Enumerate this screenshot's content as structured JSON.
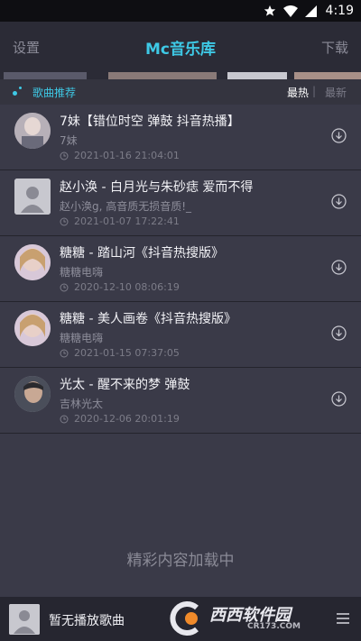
{
  "status_bar": {
    "time": "4:19"
  },
  "header": {
    "left_label": "设置",
    "title": "Mc音乐库",
    "right_label": "下载"
  },
  "section": {
    "title": "歌曲推荐",
    "sort_hot": "最热",
    "sort_separator": "|",
    "sort_new": "最新"
  },
  "songs": [
    {
      "title": "7妹【错位时空 弹鼓 抖音热播】",
      "artist": "7妹",
      "time": "2021-01-16 21:04:01",
      "avatar": "photo"
    },
    {
      "title": "赵小涣 - 白月光与朱砂痣 爱而不得",
      "artist": "赵小涣g,     高音质无损音质!_",
      "time": "2021-01-07 17:22:41",
      "avatar": "placeholder"
    },
    {
      "title": "糖糖 - 踏山河《抖音热搜版》",
      "artist": "糖糖电嗨",
      "time": "2020-12-10 08:06:19",
      "avatar": "photo"
    },
    {
      "title": "糖糖 - 美人画卷《抖音热搜版》",
      "artist": "糖糖电嗨",
      "time": "2021-01-15 07:37:05",
      "avatar": "photo"
    },
    {
      "title": "光太 - 醒不来的梦 弹鼓",
      "artist": "吉林光太",
      "time": "2020-12-06 20:01:19",
      "avatar": "photo"
    }
  ],
  "loading_text": "精彩内容加载中",
  "player": {
    "now_playing": "暂无播放歌曲"
  },
  "watermark": {
    "brand": "西西软件园",
    "domain": "CR173.COM"
  },
  "colors": {
    "accent": "#3ec9e6",
    "background": "#3a3a48",
    "header": "#2b2b36"
  }
}
